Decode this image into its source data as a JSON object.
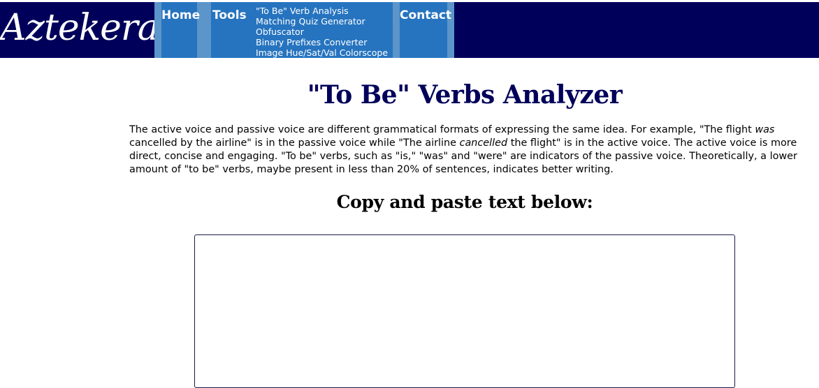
{
  "header": {
    "logo_text": "Aztekera",
    "nav": {
      "home": "Home",
      "tools": "Tools",
      "contact": "Contact"
    },
    "tools_menu": [
      "\"To Be\" Verb Analysis",
      "Matching Quiz Generator",
      "Obfuscator",
      "Binary Prefixes Converter",
      "Image Hue/Sat/Val Colorscope"
    ]
  },
  "main": {
    "title": "\"To Be\" Verbs Analyzer",
    "intro": {
      "part1": "The active voice and passive voice are different grammatical formats of expressing the same idea. For example, \"The flight ",
      "em1": "was",
      "part2": " cancelled by the airline\" is in the passive voice while \"The airline ",
      "em2": "cancelled",
      "part3": " the flight\" is in the active voice. The active voice is more direct, concise and engaging. \"To be\" verbs, such as \"is,\" \"was\" and \"were\" are indicators of the passive voice. Theoretically, a lower amount of \"to be\" verbs, maybe present in less than 20% of sentences, indicates better writing."
    },
    "subheading": "Copy and paste text below:",
    "input": {
      "value": "",
      "placeholder": ""
    }
  },
  "colors": {
    "header_bg": "#00005a",
    "nav_bg": "#2674bf",
    "nav_edge": "#5b95c9",
    "title": "#00005a"
  }
}
